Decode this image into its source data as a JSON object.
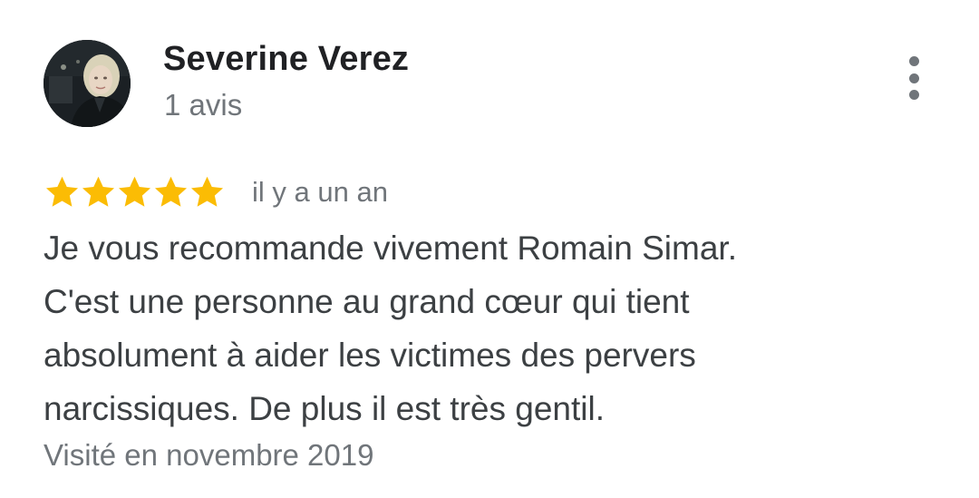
{
  "review": {
    "author": {
      "name": "Severine Verez",
      "meta": "1 avis",
      "avatar_icon": "profile-photo-avatar"
    },
    "more_icon": "more-vert-icon",
    "rating": {
      "stars": 5,
      "max": 5,
      "star_color": "#fbbc04"
    },
    "date": "il y a un an",
    "text_lines": [
      "Je vous recommande vivement Romain Simar.",
      "C'est une personne au grand cœur qui tient",
      "absolument à aider les victimes des pervers",
      "narcissiques. De plus il est très gentil."
    ],
    "visit": "Visité en novembre 2019"
  },
  "colors": {
    "name": "#202124",
    "body_text": "#3c4043",
    "secondary_text": "#70757a",
    "star": "#fbbc04"
  }
}
